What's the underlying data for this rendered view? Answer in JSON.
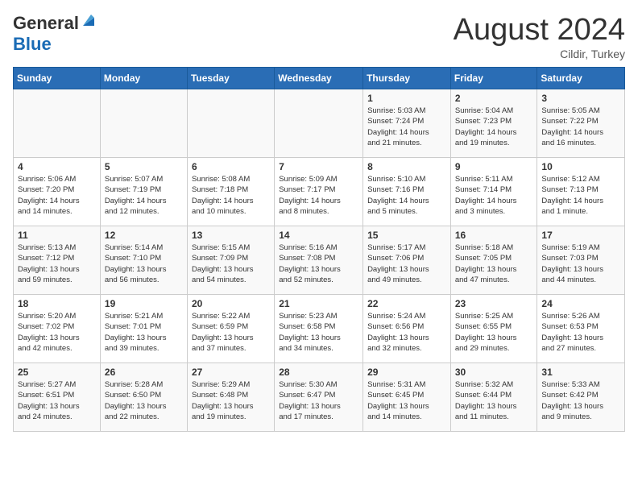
{
  "header": {
    "logo_general": "General",
    "logo_blue": "Blue",
    "month_title": "August 2024",
    "location": "Cildir, Turkey"
  },
  "days_of_week": [
    "Sunday",
    "Monday",
    "Tuesday",
    "Wednesday",
    "Thursday",
    "Friday",
    "Saturday"
  ],
  "weeks": [
    [
      {
        "day": "",
        "info": ""
      },
      {
        "day": "",
        "info": ""
      },
      {
        "day": "",
        "info": ""
      },
      {
        "day": "",
        "info": ""
      },
      {
        "day": "1",
        "info": "Sunrise: 5:03 AM\nSunset: 7:24 PM\nDaylight: 14 hours\nand 21 minutes."
      },
      {
        "day": "2",
        "info": "Sunrise: 5:04 AM\nSunset: 7:23 PM\nDaylight: 14 hours\nand 19 minutes."
      },
      {
        "day": "3",
        "info": "Sunrise: 5:05 AM\nSunset: 7:22 PM\nDaylight: 14 hours\nand 16 minutes."
      }
    ],
    [
      {
        "day": "4",
        "info": "Sunrise: 5:06 AM\nSunset: 7:20 PM\nDaylight: 14 hours\nand 14 minutes."
      },
      {
        "day": "5",
        "info": "Sunrise: 5:07 AM\nSunset: 7:19 PM\nDaylight: 14 hours\nand 12 minutes."
      },
      {
        "day": "6",
        "info": "Sunrise: 5:08 AM\nSunset: 7:18 PM\nDaylight: 14 hours\nand 10 minutes."
      },
      {
        "day": "7",
        "info": "Sunrise: 5:09 AM\nSunset: 7:17 PM\nDaylight: 14 hours\nand 8 minutes."
      },
      {
        "day": "8",
        "info": "Sunrise: 5:10 AM\nSunset: 7:16 PM\nDaylight: 14 hours\nand 5 minutes."
      },
      {
        "day": "9",
        "info": "Sunrise: 5:11 AM\nSunset: 7:14 PM\nDaylight: 14 hours\nand 3 minutes."
      },
      {
        "day": "10",
        "info": "Sunrise: 5:12 AM\nSunset: 7:13 PM\nDaylight: 14 hours\nand 1 minute."
      }
    ],
    [
      {
        "day": "11",
        "info": "Sunrise: 5:13 AM\nSunset: 7:12 PM\nDaylight: 13 hours\nand 59 minutes."
      },
      {
        "day": "12",
        "info": "Sunrise: 5:14 AM\nSunset: 7:10 PM\nDaylight: 13 hours\nand 56 minutes."
      },
      {
        "day": "13",
        "info": "Sunrise: 5:15 AM\nSunset: 7:09 PM\nDaylight: 13 hours\nand 54 minutes."
      },
      {
        "day": "14",
        "info": "Sunrise: 5:16 AM\nSunset: 7:08 PM\nDaylight: 13 hours\nand 52 minutes."
      },
      {
        "day": "15",
        "info": "Sunrise: 5:17 AM\nSunset: 7:06 PM\nDaylight: 13 hours\nand 49 minutes."
      },
      {
        "day": "16",
        "info": "Sunrise: 5:18 AM\nSunset: 7:05 PM\nDaylight: 13 hours\nand 47 minutes."
      },
      {
        "day": "17",
        "info": "Sunrise: 5:19 AM\nSunset: 7:03 PM\nDaylight: 13 hours\nand 44 minutes."
      }
    ],
    [
      {
        "day": "18",
        "info": "Sunrise: 5:20 AM\nSunset: 7:02 PM\nDaylight: 13 hours\nand 42 minutes."
      },
      {
        "day": "19",
        "info": "Sunrise: 5:21 AM\nSunset: 7:01 PM\nDaylight: 13 hours\nand 39 minutes."
      },
      {
        "day": "20",
        "info": "Sunrise: 5:22 AM\nSunset: 6:59 PM\nDaylight: 13 hours\nand 37 minutes."
      },
      {
        "day": "21",
        "info": "Sunrise: 5:23 AM\nSunset: 6:58 PM\nDaylight: 13 hours\nand 34 minutes."
      },
      {
        "day": "22",
        "info": "Sunrise: 5:24 AM\nSunset: 6:56 PM\nDaylight: 13 hours\nand 32 minutes."
      },
      {
        "day": "23",
        "info": "Sunrise: 5:25 AM\nSunset: 6:55 PM\nDaylight: 13 hours\nand 29 minutes."
      },
      {
        "day": "24",
        "info": "Sunrise: 5:26 AM\nSunset: 6:53 PM\nDaylight: 13 hours\nand 27 minutes."
      }
    ],
    [
      {
        "day": "25",
        "info": "Sunrise: 5:27 AM\nSunset: 6:51 PM\nDaylight: 13 hours\nand 24 minutes."
      },
      {
        "day": "26",
        "info": "Sunrise: 5:28 AM\nSunset: 6:50 PM\nDaylight: 13 hours\nand 22 minutes."
      },
      {
        "day": "27",
        "info": "Sunrise: 5:29 AM\nSunset: 6:48 PM\nDaylight: 13 hours\nand 19 minutes."
      },
      {
        "day": "28",
        "info": "Sunrise: 5:30 AM\nSunset: 6:47 PM\nDaylight: 13 hours\nand 17 minutes."
      },
      {
        "day": "29",
        "info": "Sunrise: 5:31 AM\nSunset: 6:45 PM\nDaylight: 13 hours\nand 14 minutes."
      },
      {
        "day": "30",
        "info": "Sunrise: 5:32 AM\nSunset: 6:44 PM\nDaylight: 13 hours\nand 11 minutes."
      },
      {
        "day": "31",
        "info": "Sunrise: 5:33 AM\nSunset: 6:42 PM\nDaylight: 13 hours\nand 9 minutes."
      }
    ]
  ]
}
